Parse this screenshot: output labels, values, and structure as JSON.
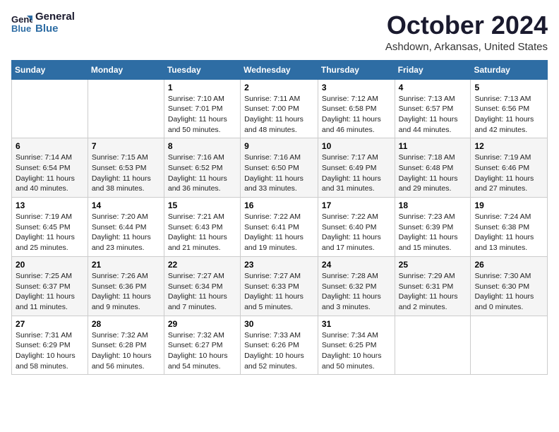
{
  "header": {
    "logo_line1": "General",
    "logo_line2": "Blue",
    "month": "October 2024",
    "location": "Ashdown, Arkansas, United States"
  },
  "weekdays": [
    "Sunday",
    "Monday",
    "Tuesday",
    "Wednesday",
    "Thursday",
    "Friday",
    "Saturday"
  ],
  "weeks": [
    [
      {
        "day": "",
        "info": ""
      },
      {
        "day": "",
        "info": ""
      },
      {
        "day": "1",
        "info": "Sunrise: 7:10 AM\nSunset: 7:01 PM\nDaylight: 11 hours and 50 minutes."
      },
      {
        "day": "2",
        "info": "Sunrise: 7:11 AM\nSunset: 7:00 PM\nDaylight: 11 hours and 48 minutes."
      },
      {
        "day": "3",
        "info": "Sunrise: 7:12 AM\nSunset: 6:58 PM\nDaylight: 11 hours and 46 minutes."
      },
      {
        "day": "4",
        "info": "Sunrise: 7:13 AM\nSunset: 6:57 PM\nDaylight: 11 hours and 44 minutes."
      },
      {
        "day": "5",
        "info": "Sunrise: 7:13 AM\nSunset: 6:56 PM\nDaylight: 11 hours and 42 minutes."
      }
    ],
    [
      {
        "day": "6",
        "info": "Sunrise: 7:14 AM\nSunset: 6:54 PM\nDaylight: 11 hours and 40 minutes."
      },
      {
        "day": "7",
        "info": "Sunrise: 7:15 AM\nSunset: 6:53 PM\nDaylight: 11 hours and 38 minutes."
      },
      {
        "day": "8",
        "info": "Sunrise: 7:16 AM\nSunset: 6:52 PM\nDaylight: 11 hours and 36 minutes."
      },
      {
        "day": "9",
        "info": "Sunrise: 7:16 AM\nSunset: 6:50 PM\nDaylight: 11 hours and 33 minutes."
      },
      {
        "day": "10",
        "info": "Sunrise: 7:17 AM\nSunset: 6:49 PM\nDaylight: 11 hours and 31 minutes."
      },
      {
        "day": "11",
        "info": "Sunrise: 7:18 AM\nSunset: 6:48 PM\nDaylight: 11 hours and 29 minutes."
      },
      {
        "day": "12",
        "info": "Sunrise: 7:19 AM\nSunset: 6:46 PM\nDaylight: 11 hours and 27 minutes."
      }
    ],
    [
      {
        "day": "13",
        "info": "Sunrise: 7:19 AM\nSunset: 6:45 PM\nDaylight: 11 hours and 25 minutes."
      },
      {
        "day": "14",
        "info": "Sunrise: 7:20 AM\nSunset: 6:44 PM\nDaylight: 11 hours and 23 minutes."
      },
      {
        "day": "15",
        "info": "Sunrise: 7:21 AM\nSunset: 6:43 PM\nDaylight: 11 hours and 21 minutes."
      },
      {
        "day": "16",
        "info": "Sunrise: 7:22 AM\nSunset: 6:41 PM\nDaylight: 11 hours and 19 minutes."
      },
      {
        "day": "17",
        "info": "Sunrise: 7:22 AM\nSunset: 6:40 PM\nDaylight: 11 hours and 17 minutes."
      },
      {
        "day": "18",
        "info": "Sunrise: 7:23 AM\nSunset: 6:39 PM\nDaylight: 11 hours and 15 minutes."
      },
      {
        "day": "19",
        "info": "Sunrise: 7:24 AM\nSunset: 6:38 PM\nDaylight: 11 hours and 13 minutes."
      }
    ],
    [
      {
        "day": "20",
        "info": "Sunrise: 7:25 AM\nSunset: 6:37 PM\nDaylight: 11 hours and 11 minutes."
      },
      {
        "day": "21",
        "info": "Sunrise: 7:26 AM\nSunset: 6:36 PM\nDaylight: 11 hours and 9 minutes."
      },
      {
        "day": "22",
        "info": "Sunrise: 7:27 AM\nSunset: 6:34 PM\nDaylight: 11 hours and 7 minutes."
      },
      {
        "day": "23",
        "info": "Sunrise: 7:27 AM\nSunset: 6:33 PM\nDaylight: 11 hours and 5 minutes."
      },
      {
        "day": "24",
        "info": "Sunrise: 7:28 AM\nSunset: 6:32 PM\nDaylight: 11 hours and 3 minutes."
      },
      {
        "day": "25",
        "info": "Sunrise: 7:29 AM\nSunset: 6:31 PM\nDaylight: 11 hours and 2 minutes."
      },
      {
        "day": "26",
        "info": "Sunrise: 7:30 AM\nSunset: 6:30 PM\nDaylight: 11 hours and 0 minutes."
      }
    ],
    [
      {
        "day": "27",
        "info": "Sunrise: 7:31 AM\nSunset: 6:29 PM\nDaylight: 10 hours and 58 minutes."
      },
      {
        "day": "28",
        "info": "Sunrise: 7:32 AM\nSunset: 6:28 PM\nDaylight: 10 hours and 56 minutes."
      },
      {
        "day": "29",
        "info": "Sunrise: 7:32 AM\nSunset: 6:27 PM\nDaylight: 10 hours and 54 minutes."
      },
      {
        "day": "30",
        "info": "Sunrise: 7:33 AM\nSunset: 6:26 PM\nDaylight: 10 hours and 52 minutes."
      },
      {
        "day": "31",
        "info": "Sunrise: 7:34 AM\nSunset: 6:25 PM\nDaylight: 10 hours and 50 minutes."
      },
      {
        "day": "",
        "info": ""
      },
      {
        "day": "",
        "info": ""
      }
    ]
  ]
}
